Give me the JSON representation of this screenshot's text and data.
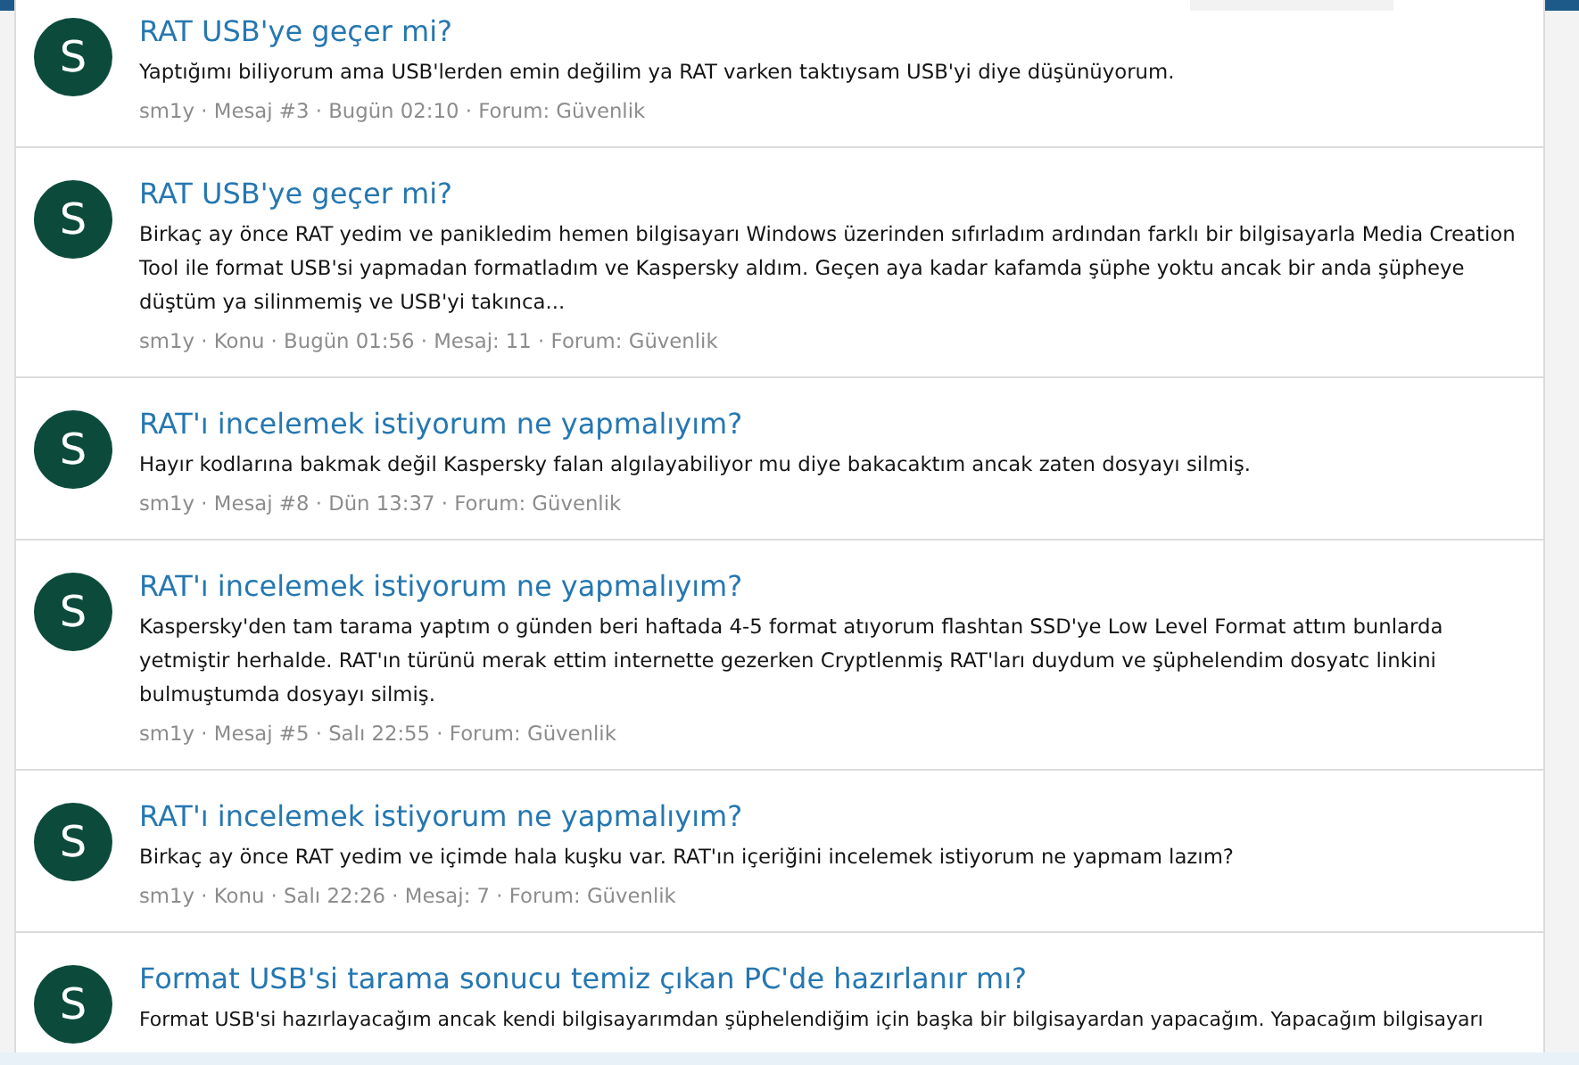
{
  "results": [
    {
      "avatar": "S",
      "title": "RAT USB'ye geçer mi?",
      "snippet": "Yaptığımı biliyorum ama USB'lerden emin değilim ya RAT varken taktıysam USB'yi diye düşünüyorum.",
      "meta": "sm1y · Mesaj #3 · Bugün 02:10 · Forum: Güvenlik"
    },
    {
      "avatar": "S",
      "title": "RAT USB'ye geçer mi?",
      "snippet": "Birkaç ay önce RAT yedim ve panikledim hemen bilgisayarı Windows üzerinden sıfırladım ardından farklı bir bilgisayarla Media Creation Tool ile format USB'si yapmadan formatladım ve Kaspersky aldım. Geçen aya kadar kafamda şüphe yoktu ancak bir anda şüpheye düştüm ya silinmemiş ve USB'yi takınca...",
      "meta": "sm1y · Konu · Bugün 01:56 · Mesaj: 11 · Forum: Güvenlik"
    },
    {
      "avatar": "S",
      "title": "RAT'ı incelemek istiyorum ne yapmalıyım?",
      "snippet": "Hayır kodlarına bakmak değil Kaspersky falan algılayabiliyor mu diye bakacaktım ancak zaten dosyayı silmiş.",
      "meta": "sm1y · Mesaj #8 · Dün 13:37 · Forum: Güvenlik"
    },
    {
      "avatar": "S",
      "title": "RAT'ı incelemek istiyorum ne yapmalıyım?",
      "snippet": "Kaspersky'den tam tarama yaptım o günden beri haftada 4-5 format atıyorum flashtan SSD'ye Low Level Format attım bunlarda yetmiştir herhalde. RAT'ın türünü merak ettim internette gezerken Cryptlenmiş RAT'ları duydum ve şüphelendim dosyatc linkini bulmuştumda dosyayı silmiş.",
      "meta": "sm1y · Mesaj #5 · Salı 22:55 · Forum: Güvenlik"
    },
    {
      "avatar": "S",
      "title": "RAT'ı incelemek istiyorum ne yapmalıyım?",
      "snippet": "Birkaç ay önce RAT yedim ve içimde hala kuşku var. RAT'ın içeriğini incelemek istiyorum ne yapmam lazım?",
      "meta": "sm1y · Konu · Salı 22:26 · Mesaj: 7 · Forum: Güvenlik"
    },
    {
      "avatar": "S",
      "title": "Format USB'si tarama sonucu temiz çıkan PC'de hazırlanır mı?",
      "snippet": "Format USB'si hazırlayacağım ancak kendi bilgisayarımdan şüphelendiğim için başka bir bilgisayardan yapacağım. Yapacağım bilgisayarı"
    }
  ]
}
